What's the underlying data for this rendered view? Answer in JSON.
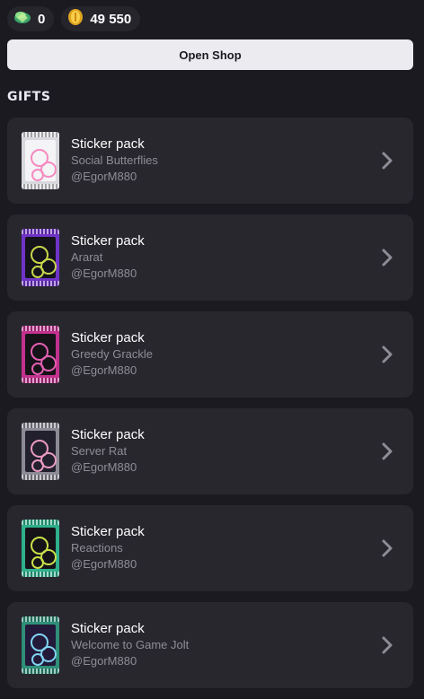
{
  "currency": {
    "gems": "0",
    "coins": "49 550"
  },
  "shop_button": "Open Shop",
  "section_title": "GIFTS",
  "gifts": [
    {
      "type": "Sticker pack",
      "name": "Social Butterflies",
      "owner": "@EgorM880",
      "pack_color": "#d8d8dd",
      "window_color": "#f4f4f6",
      "accent": "#f58ac0"
    },
    {
      "type": "Sticker pack",
      "name": "Ararat",
      "owner": "@EgorM880",
      "pack_color": "#6f33c8",
      "window_color": "#14121a",
      "accent": "#c7d64a"
    },
    {
      "type": "Sticker pack",
      "name": "Greedy Grackle",
      "owner": "@EgorM880",
      "pack_color": "#c2318e",
      "window_color": "#151318",
      "accent": "#e25fb0"
    },
    {
      "type": "Sticker pack",
      "name": "Server Rat",
      "owner": "@EgorM880",
      "pack_color": "#8c8a94",
      "window_color": "#23202d",
      "accent": "#e79ac0"
    },
    {
      "type": "Sticker pack",
      "name": "Reactions",
      "owner": "@EgorM880",
      "pack_color": "#2fb08c",
      "window_color": "#151318",
      "accent": "#c8e04a"
    },
    {
      "type": "Sticker pack",
      "name": "Welcome to Game Jolt",
      "owner": "@EgorM880",
      "pack_color": "#2f8f78",
      "window_color": "#231a3a",
      "accent": "#7fd3f0"
    }
  ]
}
